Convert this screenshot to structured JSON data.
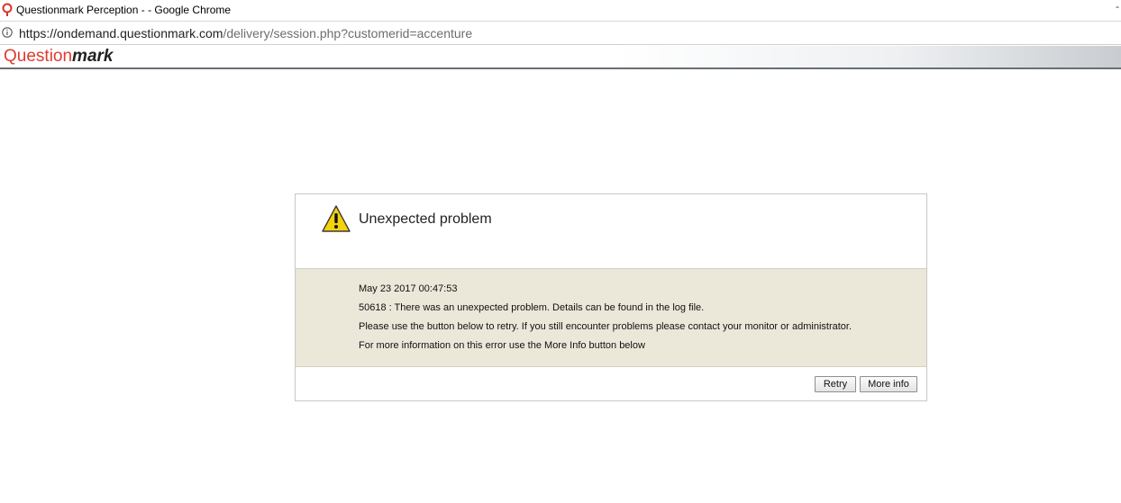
{
  "window": {
    "title": "Questionmark Perception - - Google Chrome",
    "minimize_glyph": "-"
  },
  "address_bar": {
    "url_base": "https://ondemand.questionmark.com",
    "url_path": "/delivery/session.php?customerid=accenture"
  },
  "header": {
    "logo_part1": "Question",
    "logo_part2": "mark",
    "logo_color": "#e03a2f"
  },
  "dialog": {
    "icon": "warning-icon",
    "heading": "Unexpected problem",
    "timestamp": "May 23 2017 00:47:53",
    "error_message": "50618 :  There was an unexpected problem. Details can be found in the log file.",
    "retry_instruction": "Please use the button below to retry. If you still encounter problems please contact your monitor or administrator.",
    "more_info_instruction": "For more information on this error use the More Info button below",
    "body_background": "#ebe7d9",
    "buttons": {
      "retry_label": "Retry",
      "more_info_label": "More info"
    }
  }
}
